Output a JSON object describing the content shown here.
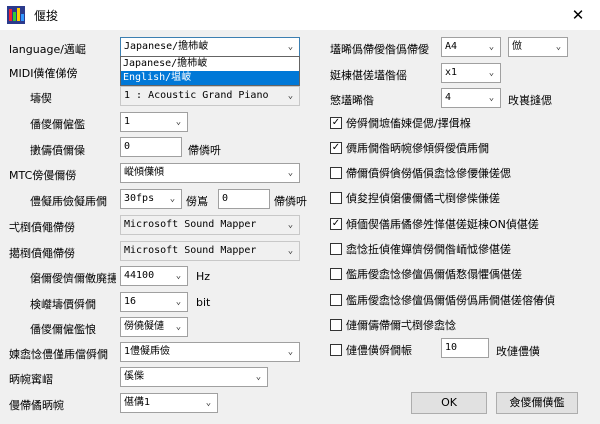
{
  "window": {
    "title": "偃捘",
    "icon": "app-icon",
    "close": "✕"
  },
  "left": {
    "language": {
      "label": "language/邁崛",
      "value": "Japanese/擔杮岥"
    },
    "language_options": [
      "Japanese/擔杮岥",
      "English/塭岥"
    ],
    "midi_label": "MIDI僙傕俤傍",
    "tone": {
      "label": "壔偰",
      "value": "1 : Acoustic Grand Piano"
    },
    "channel": {
      "label": "僠儍儞僱儖",
      "value": "1"
    },
    "velocity": {
      "label": "擻儔僨儞僺",
      "value": "0",
      "unit": "僀僯呏"
    },
    "mtc": {
      "label": "MTC傍僈儞僗",
      "value": "嵷傾僷傾"
    },
    "frame_rate": {
      "label": "僼儗乕儉儗乕僩",
      "value": "30fps",
      "mid_label": "僗嶌",
      "input": "0",
      "unit": "僀僯呏"
    },
    "output_device": {
      "label": "弌椡僨僶僀僗",
      "value": "Microsoft Sound Mapper"
    },
    "input_device": {
      "label": "擖椡僨僶僀僗",
      "value": "Microsoft Sound Mapper"
    },
    "sampling": {
      "label": "僒儞僾儕儞僌廃攇悢",
      "value": "44100",
      "unit": "Hz"
    },
    "bits": {
      "label": "検巕壔價僢僩",
      "value": "16",
      "unit": "bit"
    },
    "channels": {
      "label": "僠儍儞僱儖悢",
      "value": "僗僥儗僆"
    },
    "playback_pos": {
      "label": "媡嵞惗僼僅乕儅僢僩",
      "value": "1僼儗乕儉"
    },
    "display": {
      "label": "昞帵寗嶍",
      "value": "傒偨"
    },
    "guide": {
      "label": "僈僀僪昞帵",
      "value": "偡傋1"
    }
  },
  "right": {
    "key_sig": {
      "label": "壒晞僞僀僾偺僞僀僾",
      "value": "A4",
      "value2": "倣"
    },
    "beat_res": {
      "label": "娗棟偡傞壒偺傜",
      "value": "x1"
    },
    "beats": {
      "label": "慜壒晞偺",
      "value": "4",
      "unit": "攺嵔摓偲"
    },
    "checks": [
      {
        "label": "傍僢僩墌傗娕偍偲/擇偮椺",
        "checked": true
      },
      {
        "label": "僲乕僩偺昞帵傪傾僢僾僨乕僩",
        "checked": true
      },
      {
        "label": "僀儞僨僢僋僗偱傊嵞惗傪偠傔傞偲",
        "checked": false
      },
      {
        "label": "偵夋揑偵僒僂儞僪弌椡傪偨傔傞",
        "checked": false
      },
      {
        "label": "傾偭偰僐乕僪傪夝愅偡傞娗棟ON偵偡傞",
        "checked": true
      },
      {
        "label": "嵞惗拞偵傕嬋儕僗僩偺峏怴傪偡傞",
        "checked": false
      },
      {
        "label": "儖乕僾嵞惗傪儃僞儞偱愗傝懼偊偡傞",
        "checked": false
      },
      {
        "label": "儖乕僾嵞惗傪儃僞儞偱僗僞乕僩偡傞傛偆偵",
        "checked": false
      },
      {
        "label": "僆儞儔僀儞弌椡傪嵞惗",
        "checked": false
      },
      {
        "label": "僆僼僙僢僩帪",
        "checked": false,
        "input": "10",
        "unit": "攺僆僼僙"
      }
    ]
  },
  "buttons": {
    "ok": "OK",
    "cancel": "僉儍儞僙儖"
  }
}
